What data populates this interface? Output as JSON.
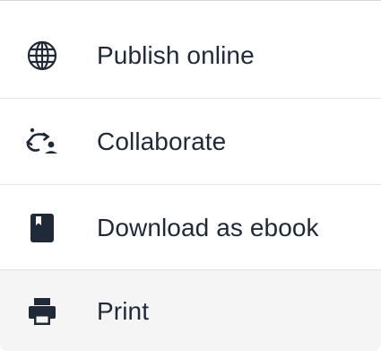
{
  "menu": {
    "items": [
      {
        "label": "Publish online",
        "icon": "globe-icon"
      },
      {
        "label": "Collaborate",
        "icon": "collaborate-icon"
      },
      {
        "label": "Download as ebook",
        "icon": "book-icon"
      },
      {
        "label": "Print",
        "icon": "printer-icon"
      }
    ]
  },
  "colors": {
    "text": "#1f2937",
    "icon": "#1f2937",
    "divider": "#e3e5e8",
    "hover_background": "#f5f5f5"
  }
}
